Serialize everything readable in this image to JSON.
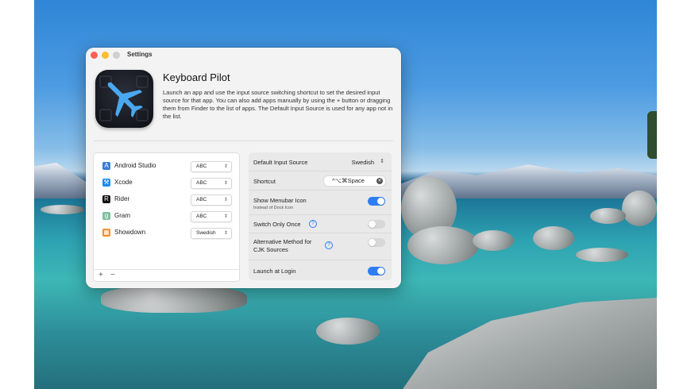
{
  "window": {
    "title": "Settings"
  },
  "app": {
    "name": "Keyboard Pilot",
    "description": "Launch an app and use the input source switching shortcut to set the desired input source for that app. You can also add apps manually by using the + button or dragging them from Finder to the list of apps. The Default Input Source is used for any app not in the list."
  },
  "apps": [
    {
      "name": "Android Studio",
      "source": "ABC",
      "icon": "android-studio-icon",
      "color": "#3c7bd6",
      "glyph": "A"
    },
    {
      "name": "Xcode",
      "source": "ABC",
      "icon": "xcode-icon",
      "color": "#1d8cf0",
      "glyph": "⚒"
    },
    {
      "name": "Rider",
      "source": "ABC",
      "icon": "rider-icon",
      "color": "#111111",
      "glyph": "R"
    },
    {
      "name": "Gram",
      "source": "ABC",
      "icon": "gram-icon",
      "color": "#7fbf9e",
      "glyph": "g"
    },
    {
      "name": "Showdown",
      "source": "Swedish",
      "icon": "showdown-icon",
      "color": "#f08c2a",
      "glyph": "▦"
    }
  ],
  "list_controls": {
    "add": "+",
    "remove": "−"
  },
  "settings": {
    "default_input_label": "Default Input Source",
    "default_input_value": "Swedish",
    "shortcut_label": "Shortcut",
    "shortcut_value": "^⌥⌘Space",
    "menubar_label": "Show Menubar Icon",
    "menubar_sub": "Instead of Dock Icon",
    "menubar_on": true,
    "switch_once_label": "Switch Only Once",
    "switch_once_on": false,
    "alt_method_label_1": "Alternative Method for",
    "alt_method_label_2": "CJK Sources",
    "alt_method_on": false,
    "login_label": "Launch at Login",
    "login_on": true
  },
  "colors": {
    "accent": "#2f7df5"
  }
}
